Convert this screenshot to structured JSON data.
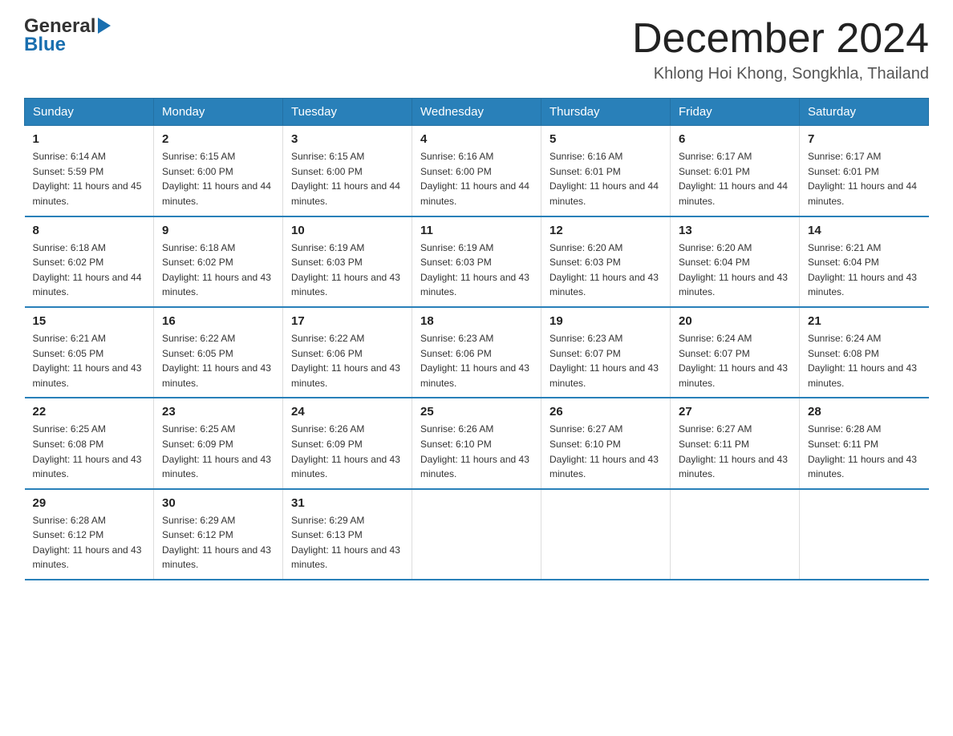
{
  "logo": {
    "general": "General",
    "arrow": "▶",
    "blue": "Blue"
  },
  "title": "December 2024",
  "location": "Khlong Hoi Khong, Songkhla, Thailand",
  "days_header": [
    "Sunday",
    "Monday",
    "Tuesday",
    "Wednesday",
    "Thursday",
    "Friday",
    "Saturday"
  ],
  "weeks": [
    [
      {
        "num": "1",
        "sunrise": "6:14 AM",
        "sunset": "5:59 PM",
        "daylight": "11 hours and 45 minutes."
      },
      {
        "num": "2",
        "sunrise": "6:15 AM",
        "sunset": "6:00 PM",
        "daylight": "11 hours and 44 minutes."
      },
      {
        "num": "3",
        "sunrise": "6:15 AM",
        "sunset": "6:00 PM",
        "daylight": "11 hours and 44 minutes."
      },
      {
        "num": "4",
        "sunrise": "6:16 AM",
        "sunset": "6:00 PM",
        "daylight": "11 hours and 44 minutes."
      },
      {
        "num": "5",
        "sunrise": "6:16 AM",
        "sunset": "6:01 PM",
        "daylight": "11 hours and 44 minutes."
      },
      {
        "num": "6",
        "sunrise": "6:17 AM",
        "sunset": "6:01 PM",
        "daylight": "11 hours and 44 minutes."
      },
      {
        "num": "7",
        "sunrise": "6:17 AM",
        "sunset": "6:01 PM",
        "daylight": "11 hours and 44 minutes."
      }
    ],
    [
      {
        "num": "8",
        "sunrise": "6:18 AM",
        "sunset": "6:02 PM",
        "daylight": "11 hours and 44 minutes."
      },
      {
        "num": "9",
        "sunrise": "6:18 AM",
        "sunset": "6:02 PM",
        "daylight": "11 hours and 43 minutes."
      },
      {
        "num": "10",
        "sunrise": "6:19 AM",
        "sunset": "6:03 PM",
        "daylight": "11 hours and 43 minutes."
      },
      {
        "num": "11",
        "sunrise": "6:19 AM",
        "sunset": "6:03 PM",
        "daylight": "11 hours and 43 minutes."
      },
      {
        "num": "12",
        "sunrise": "6:20 AM",
        "sunset": "6:03 PM",
        "daylight": "11 hours and 43 minutes."
      },
      {
        "num": "13",
        "sunrise": "6:20 AM",
        "sunset": "6:04 PM",
        "daylight": "11 hours and 43 minutes."
      },
      {
        "num": "14",
        "sunrise": "6:21 AM",
        "sunset": "6:04 PM",
        "daylight": "11 hours and 43 minutes."
      }
    ],
    [
      {
        "num": "15",
        "sunrise": "6:21 AM",
        "sunset": "6:05 PM",
        "daylight": "11 hours and 43 minutes."
      },
      {
        "num": "16",
        "sunrise": "6:22 AM",
        "sunset": "6:05 PM",
        "daylight": "11 hours and 43 minutes."
      },
      {
        "num": "17",
        "sunrise": "6:22 AM",
        "sunset": "6:06 PM",
        "daylight": "11 hours and 43 minutes."
      },
      {
        "num": "18",
        "sunrise": "6:23 AM",
        "sunset": "6:06 PM",
        "daylight": "11 hours and 43 minutes."
      },
      {
        "num": "19",
        "sunrise": "6:23 AM",
        "sunset": "6:07 PM",
        "daylight": "11 hours and 43 minutes."
      },
      {
        "num": "20",
        "sunrise": "6:24 AM",
        "sunset": "6:07 PM",
        "daylight": "11 hours and 43 minutes."
      },
      {
        "num": "21",
        "sunrise": "6:24 AM",
        "sunset": "6:08 PM",
        "daylight": "11 hours and 43 minutes."
      }
    ],
    [
      {
        "num": "22",
        "sunrise": "6:25 AM",
        "sunset": "6:08 PM",
        "daylight": "11 hours and 43 minutes."
      },
      {
        "num": "23",
        "sunrise": "6:25 AM",
        "sunset": "6:09 PM",
        "daylight": "11 hours and 43 minutes."
      },
      {
        "num": "24",
        "sunrise": "6:26 AM",
        "sunset": "6:09 PM",
        "daylight": "11 hours and 43 minutes."
      },
      {
        "num": "25",
        "sunrise": "6:26 AM",
        "sunset": "6:10 PM",
        "daylight": "11 hours and 43 minutes."
      },
      {
        "num": "26",
        "sunrise": "6:27 AM",
        "sunset": "6:10 PM",
        "daylight": "11 hours and 43 minutes."
      },
      {
        "num": "27",
        "sunrise": "6:27 AM",
        "sunset": "6:11 PM",
        "daylight": "11 hours and 43 minutes."
      },
      {
        "num": "28",
        "sunrise": "6:28 AM",
        "sunset": "6:11 PM",
        "daylight": "11 hours and 43 minutes."
      }
    ],
    [
      {
        "num": "29",
        "sunrise": "6:28 AM",
        "sunset": "6:12 PM",
        "daylight": "11 hours and 43 minutes."
      },
      {
        "num": "30",
        "sunrise": "6:29 AM",
        "sunset": "6:12 PM",
        "daylight": "11 hours and 43 minutes."
      },
      {
        "num": "31",
        "sunrise": "6:29 AM",
        "sunset": "6:13 PM",
        "daylight": "11 hours and 43 minutes."
      },
      null,
      null,
      null,
      null
    ]
  ]
}
